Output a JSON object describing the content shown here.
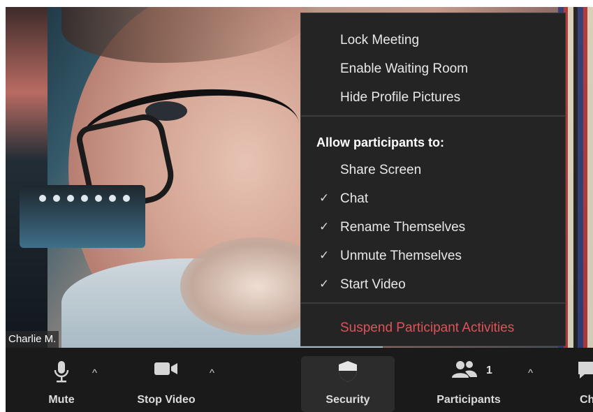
{
  "video": {
    "participant_name": "Charlie M."
  },
  "security_menu": {
    "items": [
      {
        "label": "Lock Meeting"
      },
      {
        "label": "Enable Waiting Room"
      },
      {
        "label": "Hide Profile Pictures"
      }
    ],
    "allow_header": "Allow participants to:",
    "permissions": [
      {
        "label": "Share Screen",
        "checked": false
      },
      {
        "label": "Chat",
        "checked": true
      },
      {
        "label": "Rename Themselves",
        "checked": true
      },
      {
        "label": "Unmute Themselves",
        "checked": true
      },
      {
        "label": "Start Video",
        "checked": true
      }
    ],
    "check_glyph": "✓",
    "suspend_label": "Suspend Participant Activities",
    "suspend_color": "#e0525a"
  },
  "toolbar": {
    "mute_label": "Mute",
    "stop_video_label": "Stop Video",
    "security_label": "Security",
    "participants_label": "Participants",
    "participants_count": "1",
    "chat_label": "Ch",
    "caret": "^"
  }
}
